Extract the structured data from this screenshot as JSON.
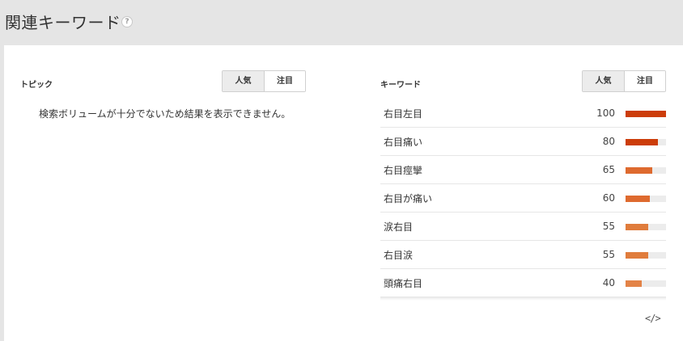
{
  "header": {
    "title": "関連キーワード",
    "help_symbol": "?"
  },
  "topics": {
    "label": "トピック",
    "toggle": [
      "人気",
      "注目"
    ],
    "active_index": 0,
    "empty_message": "検索ボリュームが十分でないため結果を表示できません。"
  },
  "keywords": {
    "label": "キーワード",
    "toggle": [
      "人気",
      "注目"
    ],
    "active_index": 0,
    "items": [
      {
        "term": "右目左目",
        "value": "100",
        "score": 100,
        "color": "#cc3d0a"
      },
      {
        "term": "右目痛い",
        "value": "80",
        "score": 80,
        "color": "#cc3d0a"
      },
      {
        "term": "右目痙攣",
        "value": "65",
        "score": 65,
        "color": "#de6a2f"
      },
      {
        "term": "右目が痛い",
        "value": "60",
        "score": 60,
        "color": "#de6a2f"
      },
      {
        "term": "涙右目",
        "value": "55",
        "score": 55,
        "color": "#e07c3c"
      },
      {
        "term": "右目涙",
        "value": "55",
        "score": 55,
        "color": "#e07c3c"
      },
      {
        "term": "頭痛右目",
        "value": "40",
        "score": 40,
        "color": "#e38347"
      }
    ]
  },
  "embed_label": "</>"
}
